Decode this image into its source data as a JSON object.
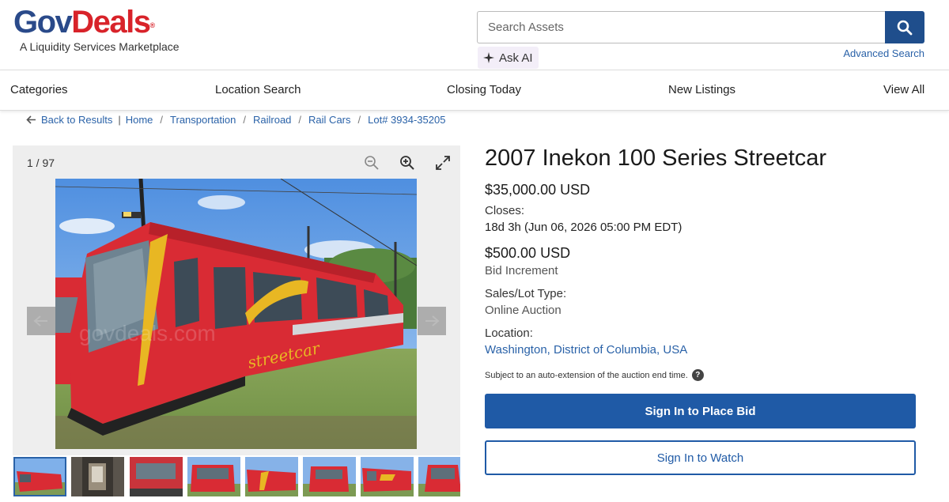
{
  "header": {
    "logo_gov": "Gov",
    "logo_deals": "Deals",
    "logo_reg": "®",
    "tagline": "A Liquidity Services Marketplace",
    "search_placeholder": "Search Assets",
    "ask_ai_label": "Ask AI",
    "advanced_search_label": "Advanced Search"
  },
  "nav": {
    "items": [
      "Categories",
      "Location Search",
      "Closing Today",
      "New Listings",
      "View All"
    ]
  },
  "breadcrumb": {
    "back_label": "Back to Results",
    "crumbs": [
      "Home",
      "Transportation",
      "Railroad",
      "Rail Cars",
      "Lot# 3934-35205"
    ]
  },
  "gallery": {
    "counter": "1 / 97",
    "watermark": "govdeals.com",
    "thumbnails": [
      "thumb-1",
      "thumb-2",
      "thumb-3",
      "thumb-4",
      "thumb-5",
      "thumb-6",
      "thumb-7",
      "thumb-8"
    ]
  },
  "listing": {
    "title": "2007 Inekon 100 Series Streetcar",
    "current_price": "$35,000.00 USD",
    "closes_label": "Closes:",
    "closes_value": "18d 3h (Jun 06, 2026 05:00 PM EDT)",
    "bid_increment_value": "$500.00 USD",
    "bid_increment_label": "Bid Increment",
    "sales_type_label": "Sales/Lot Type:",
    "sales_type_value": "Online Auction",
    "location_label": "Location:",
    "location_value": "Washington, District of Columbia, USA",
    "auto_extension_note": "Subject to an auto-extension of the auction end time.",
    "help_glyph": "?",
    "bid_button_label": "Sign In to Place Bid",
    "watch_button_label": "Sign In to Watch"
  },
  "colors": {
    "brand_blue": "#1f5aa6",
    "link_blue": "#2a62a8",
    "logo_red": "#d8232a",
    "streetcar_red": "#d92b34"
  }
}
